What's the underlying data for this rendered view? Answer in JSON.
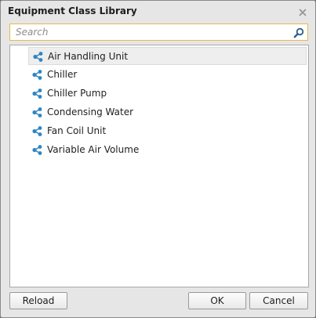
{
  "dialog": {
    "title": "Equipment Class Library",
    "close_icon": "close-x-icon"
  },
  "search": {
    "placeholder": "Search",
    "value": "",
    "icon": "search-icon"
  },
  "list": {
    "item_icon": "share-nodes-icon",
    "icon_color": "#2e86c1",
    "selected_index": 0,
    "items": [
      {
        "label": "Air Handling Unit"
      },
      {
        "label": "Chiller"
      },
      {
        "label": "Chiller Pump"
      },
      {
        "label": "Condensing Water"
      },
      {
        "label": "Fan Coil Unit"
      },
      {
        "label": "Variable Air Volume"
      }
    ]
  },
  "buttons": {
    "reload": "Reload",
    "ok": "OK",
    "cancel": "Cancel"
  },
  "colors": {
    "search_border": "#e8b84a",
    "dialog_bg": "#e6e6e6",
    "selected_row": "#eeeeee"
  }
}
